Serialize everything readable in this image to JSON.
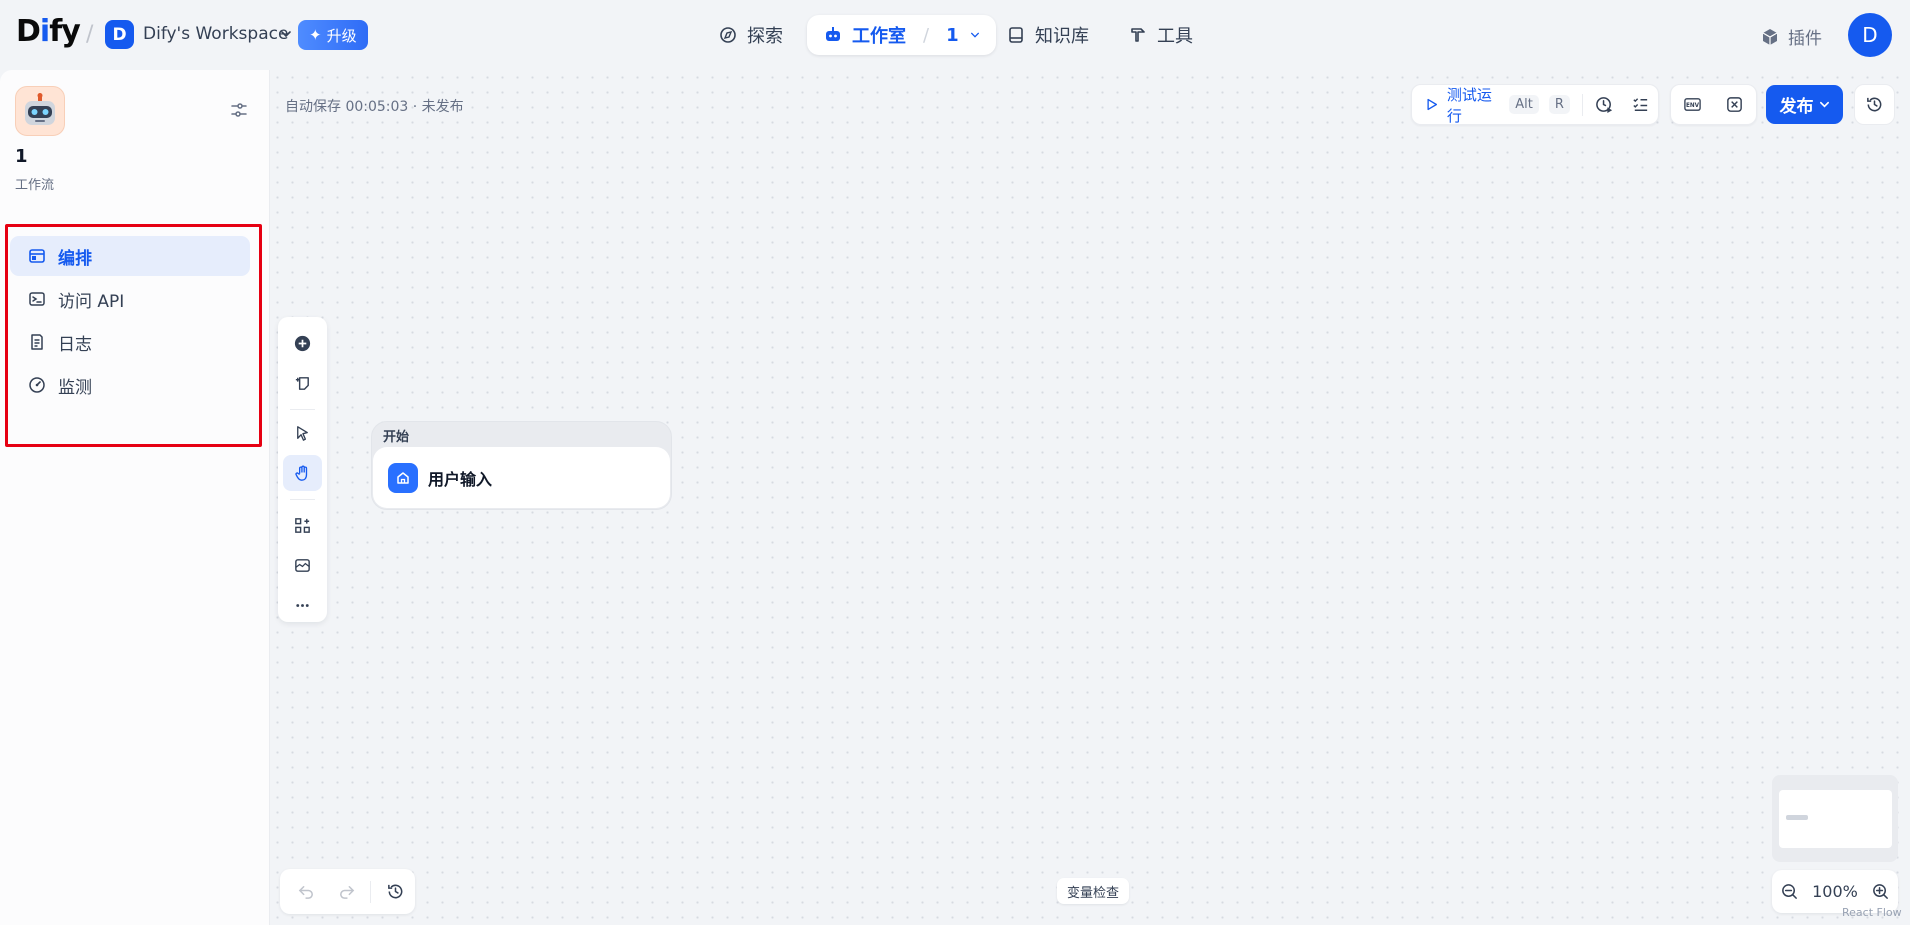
{
  "header": {
    "logo": "Dify",
    "breadcrumb_sep": "/",
    "workspace_initial": "D",
    "workspace_name": "Dify's Workspace",
    "upgrade_label": "升级",
    "nav": {
      "explore": "探索",
      "studio": "工作室",
      "studio_app": "1",
      "knowledge": "知识库",
      "tools": "工具"
    },
    "plugins": "插件",
    "user_initial": "D"
  },
  "sidebar": {
    "app_name": "1",
    "app_type": "工作流",
    "items": [
      {
        "label": "编排",
        "icon": "layout-icon",
        "active": true
      },
      {
        "label": "访问 API",
        "icon": "terminal-icon",
        "active": false
      },
      {
        "label": "日志",
        "icon": "log-icon",
        "active": false
      },
      {
        "label": "监测",
        "icon": "gauge-icon",
        "active": false
      }
    ]
  },
  "canvas": {
    "autosave_text": "自动保存 00:05:03 · 未发布",
    "test_run_label": "测试运行",
    "shortcut_key1": "Alt",
    "shortcut_key2": "R",
    "publish_label": "发布",
    "start_node": {
      "section_label": "开始",
      "title": "用户输入"
    },
    "variable_inspect": "变量检查",
    "zoom": "100%",
    "attribution": "React Flow"
  },
  "colors": {
    "accent": "#155aef",
    "highlight_box": "#e60012"
  }
}
